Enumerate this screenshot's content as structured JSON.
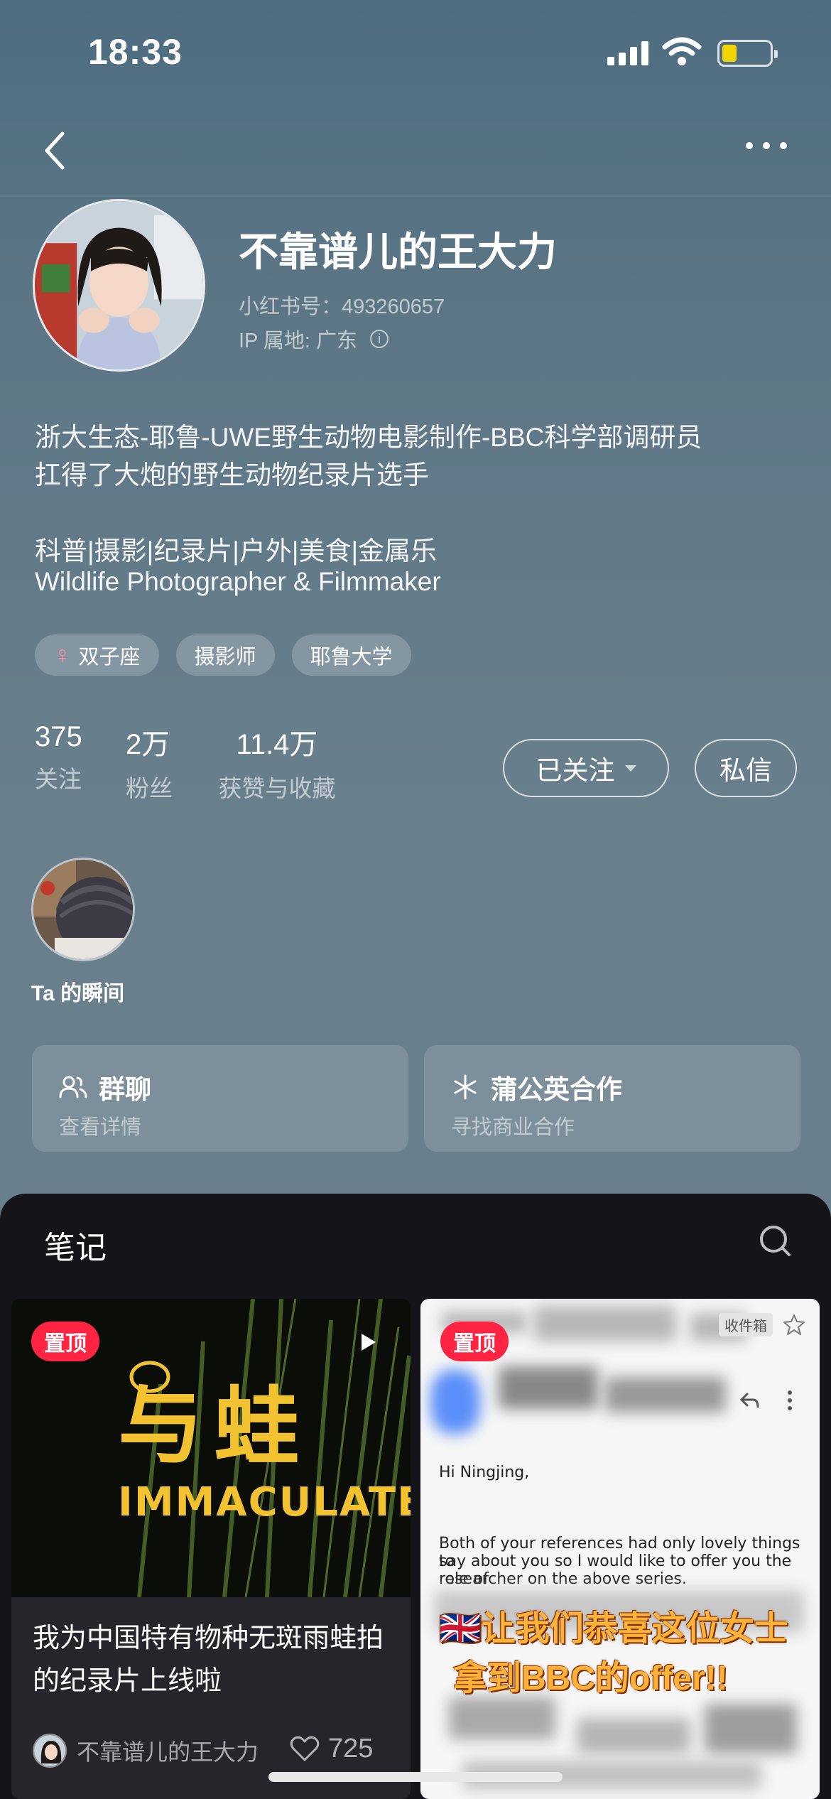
{
  "status_bar": {
    "time": "18:33"
  },
  "profile": {
    "name": "不靠谱儿的王大力",
    "red_id": "小红书号：493260657",
    "ip": "IP 属地: 广东",
    "bio_lines": [
      "浙大生态-耶鲁-UWE野生动物电影制作-BBC科学部调研员",
      "扛得了大炮的野生动物纪录片选手",
      "科普|摄影|纪录片|户外|美食|金属乐",
      "Wildlife Photographer & Filmmaker"
    ],
    "tags": [
      "双子座",
      "摄影师",
      "耶鲁大学"
    ],
    "stats": [
      {
        "value": "375",
        "label": "关注"
      },
      {
        "value": "2万",
        "label": "粉丝"
      },
      {
        "value": "11.4万",
        "label": "获赞与收藏"
      }
    ],
    "follow_label": "已关注",
    "message_label": "私信",
    "moments_label": "Ta 的瞬间",
    "cards": [
      {
        "title": "群聊",
        "subtitle": "查看详情",
        "icon": "group-icon"
      },
      {
        "title": "蒲公英合作",
        "subtitle": "寻找商业合作",
        "icon": "dandelion-icon"
      }
    ]
  },
  "notes": {
    "tab_label": "笔记",
    "items": [
      {
        "pinned_label": "置顶",
        "cover_title_cn": "蛙",
        "cover_title_en": "IMMACULATE",
        "caption": "我为中国特有物种无斑雨蛙拍的纪录片上线啦",
        "author": "不靠谱儿的王大力",
        "likes": "725",
        "is_video": true
      },
      {
        "pinned_label": "置顶",
        "email_greeting": "Hi Ningjing,",
        "email_body": [
          "Both of  your references had only lovely things to",
          "say about you so I would like to offer you the role of",
          "researcher on the above series."
        ],
        "mailbox_tag": "收件箱",
        "promo_lines": [
          "🇬🇧让我们恭喜这位女士",
          "拿到BBC的offer!!"
        ]
      }
    ]
  },
  "colors": {
    "accent": "#ff2442",
    "panel": "#141419"
  }
}
